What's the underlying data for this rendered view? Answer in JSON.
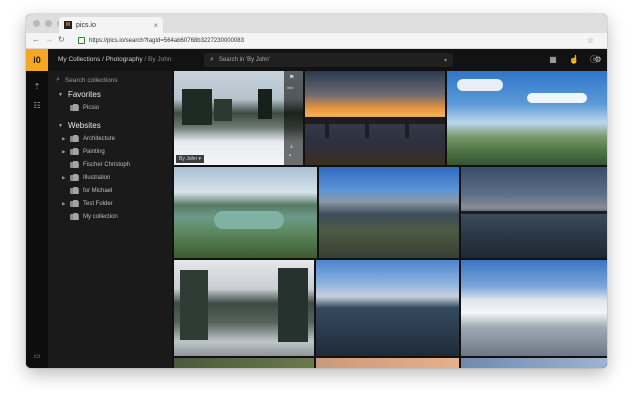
{
  "browser": {
    "tab_title": "pics.io",
    "favicon_text": "i0",
    "url": "https://pics.io/search?tagId=564ab60768b3227230000083"
  },
  "app": {
    "logo_text": "i0",
    "breadcrumb": {
      "root": "My Collections",
      "sep1": "/",
      "parent": "Photography",
      "sep2": "/",
      "current": "By John"
    },
    "search_placeholder": "Search in 'By John'",
    "sidebar": {
      "search_placeholder": "Search collections",
      "favorites_title": "Favorites",
      "favorites": [
        "Picsio"
      ],
      "websites_title": "Websites",
      "websites": [
        {
          "label": "Architecture",
          "expandable": true
        },
        {
          "label": "Painting",
          "expandable": true
        },
        {
          "label": "Fischer Christoph",
          "expandable": false
        },
        {
          "label": "Illustration",
          "expandable": true
        },
        {
          "label": "for Michael",
          "expandable": false
        },
        {
          "label": "Test Folder",
          "expandable": true
        },
        {
          "label": "My collection",
          "expandable": false
        }
      ]
    },
    "grid": {
      "selected_tag": "By John",
      "overlay_label": "info",
      "photos": [
        "snowy-forest-road",
        "pier-at-sunset",
        "mountain-coast-blue-sky",
        "green-lake-valley",
        "mountain-valley-river",
        "lake-bridge-dusk",
        "snowy-pine-trees-road",
        "mountain-range-clouds",
        "snowy-mountain-peaks",
        "sunset-strip"
      ]
    }
  },
  "colors": {
    "accent": "#f5a623",
    "sidebar_bg": "#1a1a1a",
    "topbar_bg": "#121212"
  }
}
